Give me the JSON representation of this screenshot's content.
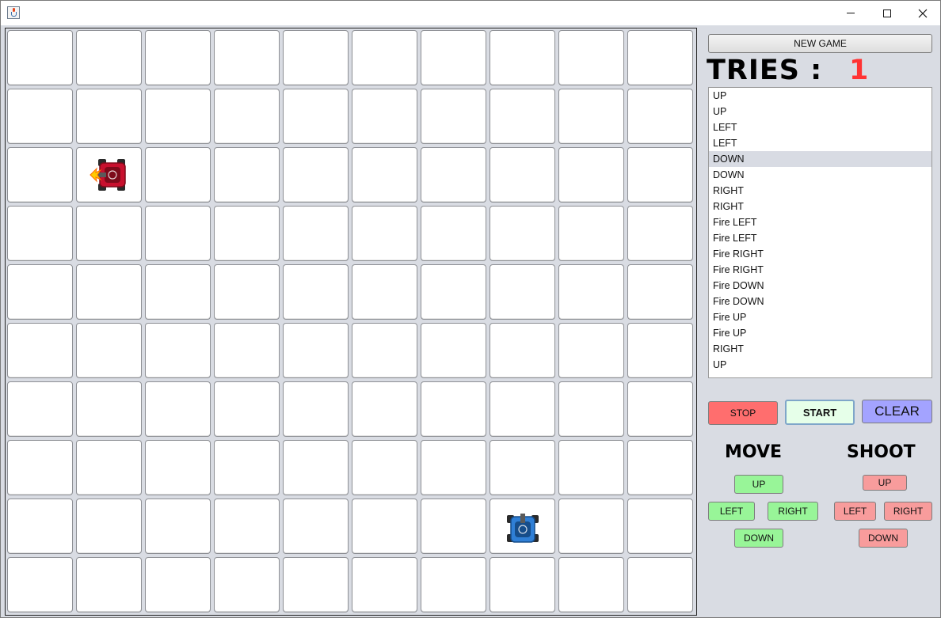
{
  "window": {
    "title": "",
    "icon": "java-cup-icon",
    "controls": [
      "minimize-icon",
      "maximize-icon",
      "close-icon"
    ]
  },
  "board": {
    "rows": 10,
    "cols": 10,
    "units": [
      {
        "name": "red-tank",
        "row": 2,
        "col": 1,
        "color": "#c8102e",
        "facing": "left",
        "firing": true
      },
      {
        "name": "blue-tank",
        "row": 8,
        "col": 7,
        "color": "#2f7fd6",
        "facing": "up",
        "firing": false
      }
    ]
  },
  "panel": {
    "new_game_label": "NEW GAME",
    "tries_label": "TRIES :",
    "tries_value": "1",
    "commands": [
      "UP",
      "UP",
      "LEFT",
      "LEFT",
      "DOWN",
      "DOWN",
      "RIGHT",
      "RIGHT",
      "Fire LEFT",
      "Fire LEFT",
      "Fire RIGHT",
      "Fire RIGHT",
      "Fire DOWN",
      "Fire DOWN",
      "Fire UP",
      "Fire UP",
      "RIGHT",
      "UP"
    ],
    "selected_command_index": 4,
    "stop_label": "STOP",
    "start_label": "START",
    "clear_label": "CLEAR",
    "move": {
      "label": "MOVE",
      "up": "UP",
      "left": "LEFT",
      "right": "RIGHT",
      "down": "DOWN"
    },
    "shoot": {
      "label": "SHOOT",
      "up": "UP",
      "left": "LEFT",
      "right": "RIGHT",
      "down": "DOWN"
    }
  },
  "colors": {
    "tries_value": "#ff3333",
    "stop": "#ff6e6e",
    "start": "#e6ffe9",
    "clear": "#a3a3ff",
    "move_buttons": "#98f598",
    "shoot_buttons": "#f89c9c"
  }
}
